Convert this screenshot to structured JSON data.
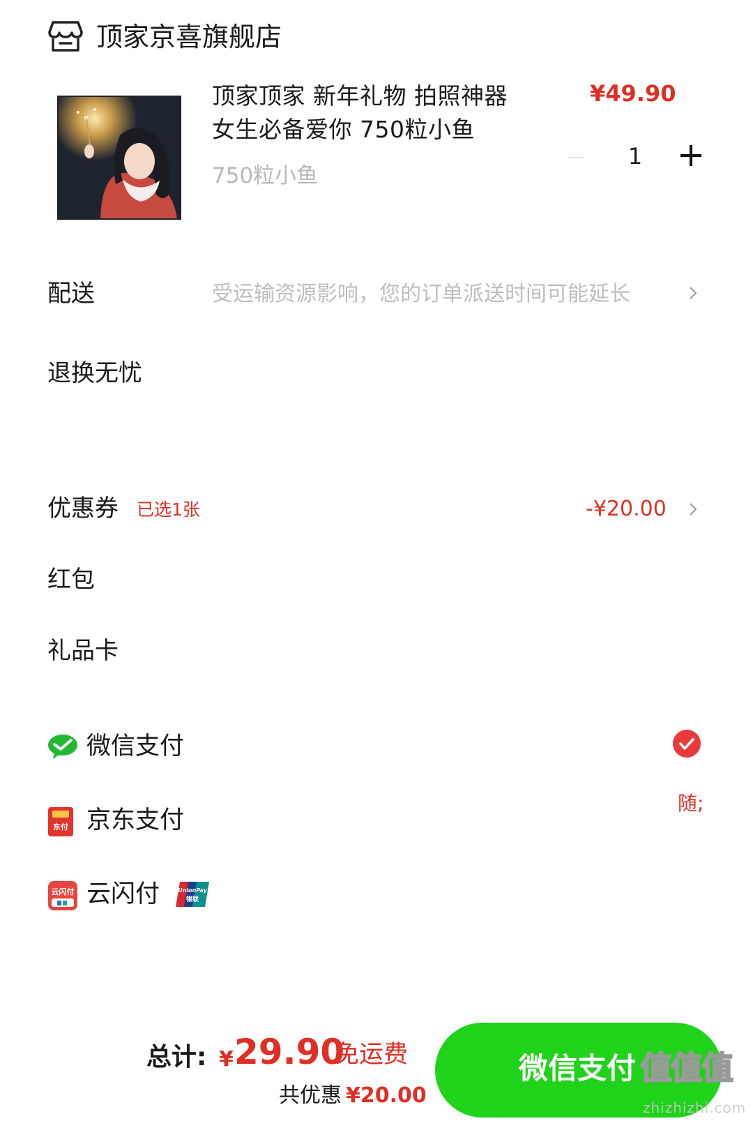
{
  "store": {
    "name": "顶家京喜旗舰店",
    "icon": "store-icon"
  },
  "product": {
    "title": "顶家顶家  新年礼物 拍照神器女生必备爱你 750粒小鱼",
    "price": "¥49.90",
    "spec": "750粒小鱼",
    "quantity": "1",
    "image_icon": "product-image"
  },
  "delivery": {
    "label": "配送",
    "note": "受运输资源影响，您的订单派送时间可能延长"
  },
  "returns": {
    "label": "退换无忧"
  },
  "coupon": {
    "label": "优惠券",
    "badge": "已选1张",
    "amount": "-¥20.00"
  },
  "red_packet": {
    "label": "红包"
  },
  "gift_card": {
    "label": "礼品卡"
  },
  "payment_methods": [
    {
      "label": "微信支付",
      "icon": "wechat-pay-icon",
      "selected": true
    },
    {
      "label": "京东支付",
      "icon": "jd-pay-icon",
      "promo": "随;"
    },
    {
      "label": "云闪付",
      "icon": "yunshanfu-icon",
      "badge_icon": "unionpay-logo"
    }
  ],
  "footer": {
    "total_label": "总计:",
    "currency": "¥",
    "total_amount": "29.90",
    "free_shipping": "免运费",
    "discount_label": "共优惠",
    "discount_amount": "¥20.00",
    "pay_button_label": "微信支付"
  },
  "watermark": {
    "text": "值值值",
    "domain": "zhizhizhi.com"
  },
  "colors": {
    "accent_red": "#e02e24",
    "pay_green": "#1fd21a",
    "muted_text": "#bdbdbd"
  }
}
